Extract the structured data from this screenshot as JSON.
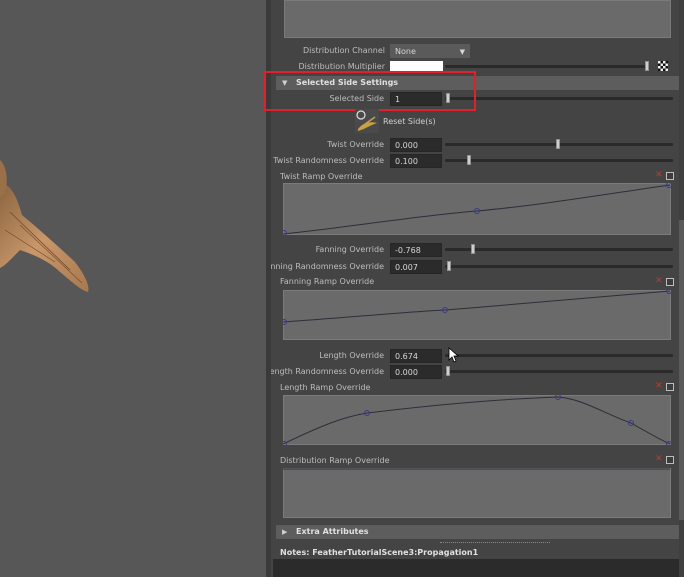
{
  "channel": {
    "label": "Distribution Channel",
    "value": "None"
  },
  "multiplier": {
    "label": "Distribution Multiplier"
  },
  "selected_side_section": {
    "title": "Selected Side Settings"
  },
  "selected_side": {
    "label": "Selected Side",
    "value": "1"
  },
  "reset": {
    "label": "Reset Side(s)"
  },
  "twist": {
    "label": "Twist Override",
    "value": "0.000",
    "slider": 0.5
  },
  "twist_rand": {
    "label": "Twist Randomness Override",
    "value": "0.100",
    "slider": 0.1
  },
  "twist_ramp": {
    "label": "Twist Ramp Override"
  },
  "fanning": {
    "label": "Fanning Override",
    "value": "-0.768",
    "slider": 0.116
  },
  "fanning_rand": {
    "label": "Fanning Randomness Override",
    "value": "0.007",
    "slider": 0.007
  },
  "fanning_ramp": {
    "label": "Fanning Ramp Override"
  },
  "length": {
    "label": "Length Override",
    "value": "0.674",
    "slider": 0.0
  },
  "length_rand": {
    "label": "Length Randomness Override",
    "value": "0.000",
    "slider": 0.0
  },
  "length_ramp": {
    "label": "Length Ramp Override"
  },
  "dist_ramp": {
    "label": "Distribution Ramp Override"
  },
  "extra": {
    "title": "Extra Attributes"
  },
  "notes": {
    "text": "Notes:  FeatherTutorialScene3:Propagation1"
  },
  "colors": {
    "highlight_box": "#e0202b",
    "ramp_fill": "#6a6a6a",
    "curve": "#2e2e3a"
  }
}
